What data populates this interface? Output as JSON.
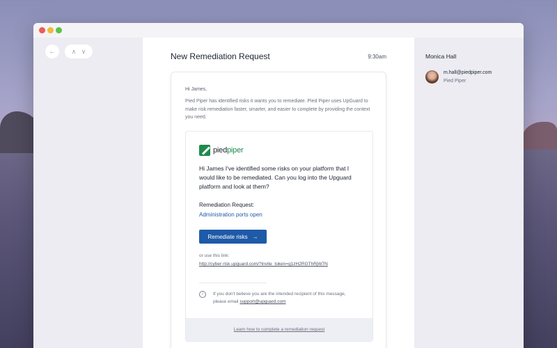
{
  "window": {
    "controls": [
      "close",
      "minimize",
      "maximize"
    ],
    "nav": {
      "back_icon": "arrow-left-icon",
      "prev_icon": "chevron-up-icon",
      "next_icon": "chevron-down-icon"
    }
  },
  "email": {
    "subject": "New Remediation Request",
    "time": "9:30am",
    "greeting": "Hi James,",
    "intro": "Pied Piper has identified risks it wants you to remediate. Pied Piper uses UpGuard to make risk remediation faster, smarter, and easier to complete by providing the context you need.",
    "logo": {
      "part1": "pied",
      "part2": "piper",
      "brand_color": "#1f8a4c"
    },
    "message": "Hi James I've identified some risks on your platform that I would like to be remediated. Can you log into the Upguard platform and look at them?",
    "request_label": "Remediation Request:",
    "request_item": "Administration ports open",
    "cta_label": "Remediate risks",
    "cta_arrow": "→",
    "cta_color": "#1e5aa8",
    "alt_label": "or use this link:",
    "alt_link": "http://cyber-risk.upguard.com/?invite_token=g1zH2RGThRjW7N",
    "info_icon_glyph": "i",
    "disclaimer_text": "If you don't believe you are the intended recipient of this message, please email ",
    "support_email": "support@upguard.com",
    "learn_link": "Learn how to complete a remediation request"
  },
  "sender": {
    "name": "Monica Hall",
    "email": "m.hall@piedpiper.com",
    "org": "Pied Piper"
  }
}
